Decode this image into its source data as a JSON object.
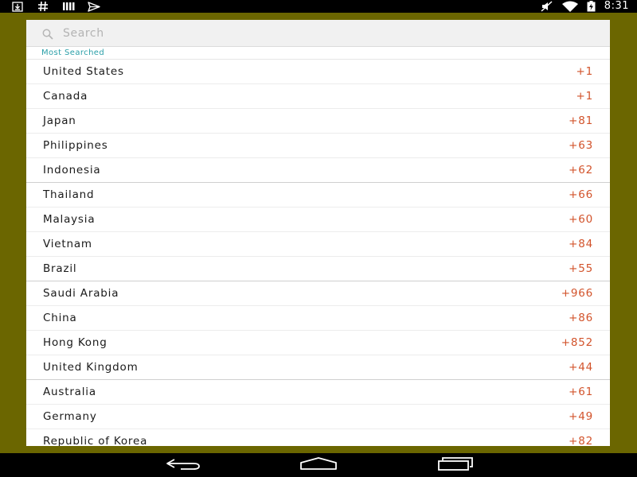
{
  "status_bar": {
    "time": "8:31",
    "left_icons": [
      "download-icon",
      "hashtag-icon",
      "signal-bars-icon",
      "send-icon"
    ],
    "right_icons": [
      "muted-icon",
      "wifi-icon",
      "battery-charging-icon"
    ]
  },
  "search": {
    "placeholder": "Search",
    "value": ""
  },
  "list": {
    "section_header": "Most Searched",
    "rows": [
      {
        "name": "United States",
        "code": "+1"
      },
      {
        "name": "Canada",
        "code": "+1"
      },
      {
        "name": "Japan",
        "code": "+81"
      },
      {
        "name": "Philippines",
        "code": "+63"
      },
      {
        "name": "Indonesia",
        "code": "+62"
      },
      {
        "name": "Thailand",
        "code": "+66"
      },
      {
        "name": "Malaysia",
        "code": "+60"
      },
      {
        "name": "Vietnam",
        "code": "+84"
      },
      {
        "name": "Brazil",
        "code": "+55"
      },
      {
        "name": "Saudi Arabia",
        "code": "+966"
      },
      {
        "name": "China",
        "code": "+86"
      },
      {
        "name": "Hong Kong",
        "code": "+852"
      },
      {
        "name": "United Kingdom",
        "code": "+44"
      },
      {
        "name": "Australia",
        "code": "+61"
      },
      {
        "name": "Germany",
        "code": "+49"
      },
      {
        "name": "Republic of Korea",
        "code": "+82"
      }
    ]
  },
  "nav_bar": {
    "buttons": [
      "back-icon",
      "home-icon",
      "recents-icon"
    ]
  },
  "colors": {
    "background": "#6b6600",
    "accent": "#2a9fa8",
    "code_text": "#d2532b"
  }
}
